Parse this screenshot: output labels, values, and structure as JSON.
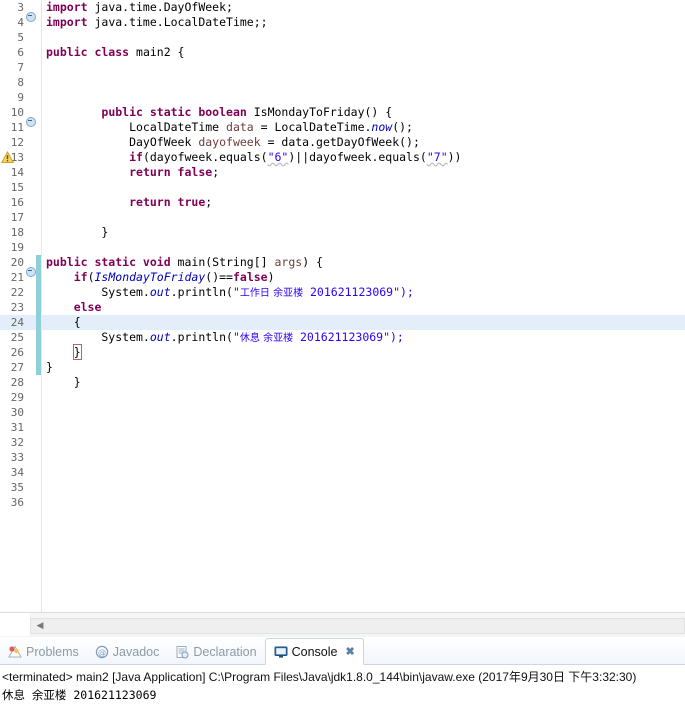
{
  "editor": {
    "first_line": 3,
    "current_line": 24,
    "warning_line": 13,
    "lines": [
      {
        "n": 3,
        "fold": true,
        "change": false,
        "warn": false,
        "tokens": [
          {
            "t": "import",
            "c": "kw"
          },
          {
            "t": " java.time.DayOfWeek;",
            "c": "pln"
          }
        ]
      },
      {
        "n": 4,
        "fold": false,
        "change": false,
        "warn": false,
        "tokens": [
          {
            "t": "import",
            "c": "kw"
          },
          {
            "t": " java.time.LocalDateTime;;",
            "c": "pln"
          }
        ]
      },
      {
        "n": 5,
        "fold": false,
        "change": false,
        "warn": false,
        "tokens": []
      },
      {
        "n": 6,
        "fold": false,
        "change": false,
        "warn": false,
        "tokens": [
          {
            "t": "public class",
            "c": "kw"
          },
          {
            "t": " main2 {",
            "c": "pln"
          }
        ]
      },
      {
        "n": 7,
        "fold": false,
        "change": false,
        "warn": false,
        "tokens": []
      },
      {
        "n": 8,
        "fold": false,
        "change": false,
        "warn": false,
        "tokens": []
      },
      {
        "n": 9,
        "fold": false,
        "change": false,
        "warn": false,
        "tokens": []
      },
      {
        "n": 10,
        "fold": true,
        "change": false,
        "warn": false,
        "tokens": [
          {
            "t": "        ",
            "c": "pln"
          },
          {
            "t": "public static boolean",
            "c": "kw"
          },
          {
            "t": " IsMondayToFriday() {",
            "c": "pln"
          }
        ]
      },
      {
        "n": 11,
        "fold": false,
        "change": false,
        "warn": false,
        "tokens": [
          {
            "t": "            LocalDateTime ",
            "c": "pln"
          },
          {
            "t": "data",
            "c": "param"
          },
          {
            "t": " = LocalDateTime.",
            "c": "pln"
          },
          {
            "t": "now",
            "c": "stat"
          },
          {
            "t": "();",
            "c": "pln"
          }
        ]
      },
      {
        "n": 12,
        "fold": false,
        "change": false,
        "warn": false,
        "tokens": [
          {
            "t": "            DayOfWeek ",
            "c": "pln"
          },
          {
            "t": "dayofweek",
            "c": "param"
          },
          {
            "t": " = data.getDayOfWeek();",
            "c": "pln"
          }
        ]
      },
      {
        "n": 13,
        "fold": false,
        "change": false,
        "warn": true,
        "tokens": [
          {
            "t": "            ",
            "c": "pln"
          },
          {
            "t": "if",
            "c": "kw"
          },
          {
            "t": "(dayofweek.equals(",
            "c": "pln"
          },
          {
            "t": "\"6\"",
            "c": "str sq"
          },
          {
            "t": ")||dayofweek.equals(",
            "c": "pln"
          },
          {
            "t": "\"7\"",
            "c": "str sq"
          },
          {
            "t": "))",
            "c": "pln"
          }
        ]
      },
      {
        "n": 14,
        "fold": false,
        "change": false,
        "warn": false,
        "tokens": [
          {
            "t": "            ",
            "c": "pln"
          },
          {
            "t": "return false",
            "c": "kw"
          },
          {
            "t": ";",
            "c": "pln"
          }
        ]
      },
      {
        "n": 15,
        "fold": false,
        "change": false,
        "warn": false,
        "tokens": []
      },
      {
        "n": 16,
        "fold": false,
        "change": false,
        "warn": false,
        "tokens": [
          {
            "t": "            ",
            "c": "pln"
          },
          {
            "t": "return true",
            "c": "kw"
          },
          {
            "t": ";",
            "c": "pln"
          }
        ]
      },
      {
        "n": 17,
        "fold": false,
        "change": false,
        "warn": false,
        "tokens": []
      },
      {
        "n": 18,
        "fold": false,
        "change": false,
        "warn": false,
        "tokens": [
          {
            "t": "        }",
            "c": "pln"
          }
        ]
      },
      {
        "n": 19,
        "fold": false,
        "change": false,
        "warn": false,
        "tokens": []
      },
      {
        "n": 20,
        "fold": true,
        "change": true,
        "warn": false,
        "tokens": [
          {
            "t": "public static void",
            "c": "kw"
          },
          {
            "t": " main(String[] ",
            "c": "pln"
          },
          {
            "t": "args",
            "c": "param"
          },
          {
            "t": ") {",
            "c": "pln"
          }
        ]
      },
      {
        "n": 21,
        "fold": false,
        "change": true,
        "warn": false,
        "tokens": [
          {
            "t": "    ",
            "c": "pln"
          },
          {
            "t": "if",
            "c": "kw"
          },
          {
            "t": "(",
            "c": "pln"
          },
          {
            "t": "IsMondayToFriday",
            "c": "stat"
          },
          {
            "t": "()==",
            "c": "pln"
          },
          {
            "t": "false",
            "c": "kw"
          },
          {
            "t": ")",
            "c": "pln"
          }
        ]
      },
      {
        "n": 22,
        "fold": false,
        "change": true,
        "warn": false,
        "tokens": [
          {
            "t": "        System.",
            "c": "pln"
          },
          {
            "t": "out",
            "c": "fld"
          },
          {
            "t": ".println(",
            "c": "pln"
          },
          {
            "t": "\"",
            "c": "str"
          },
          {
            "t": "工作日 余亚楼",
            "c": "str cjk"
          },
          {
            "t": " 201621123069\");",
            "c": "str"
          }
        ]
      },
      {
        "n": 23,
        "fold": false,
        "change": true,
        "warn": false,
        "tokens": [
          {
            "t": "    ",
            "c": "pln"
          },
          {
            "t": "else",
            "c": "kw"
          }
        ]
      },
      {
        "n": 24,
        "fold": false,
        "change": true,
        "warn": false,
        "tokens": [
          {
            "t": "    {",
            "c": "pln"
          }
        ]
      },
      {
        "n": 25,
        "fold": false,
        "change": true,
        "warn": false,
        "tokens": [
          {
            "t": "        System.",
            "c": "pln"
          },
          {
            "t": "out",
            "c": "fld"
          },
          {
            "t": ".println(",
            "c": "pln"
          },
          {
            "t": "\"",
            "c": "str"
          },
          {
            "t": "休息 余亚楼",
            "c": "str cjk"
          },
          {
            "t": " 201621123069\");",
            "c": "str"
          }
        ]
      },
      {
        "n": 26,
        "fold": false,
        "change": true,
        "warn": false,
        "tokens": [
          {
            "t": "    ",
            "c": "pln"
          },
          {
            "t": "}",
            "c": "pln bracketbox"
          }
        ]
      },
      {
        "n": 27,
        "fold": false,
        "change": true,
        "warn": false,
        "tokens": [
          {
            "t": "}",
            "c": "pln"
          }
        ]
      },
      {
        "n": 28,
        "fold": false,
        "change": false,
        "warn": false,
        "tokens": [
          {
            "t": "    }",
            "c": "pln"
          }
        ]
      },
      {
        "n": 29,
        "fold": false,
        "change": false,
        "warn": false,
        "tokens": []
      },
      {
        "n": 30,
        "fold": false,
        "change": false,
        "warn": false,
        "tokens": []
      },
      {
        "n": 31,
        "fold": false,
        "change": false,
        "warn": false,
        "tokens": []
      },
      {
        "n": 32,
        "fold": false,
        "change": false,
        "warn": false,
        "tokens": []
      },
      {
        "n": 33,
        "fold": false,
        "change": false,
        "warn": false,
        "tokens": []
      },
      {
        "n": 34,
        "fold": false,
        "change": false,
        "warn": false,
        "tokens": []
      },
      {
        "n": 35,
        "fold": false,
        "change": false,
        "warn": false,
        "tokens": []
      },
      {
        "n": 36,
        "fold": false,
        "change": false,
        "warn": false,
        "tokens": []
      }
    ]
  },
  "scrollbar": {
    "left_arrow": "◀"
  },
  "panel": {
    "tabs": [
      {
        "label": "Problems",
        "icon": "problems-icon",
        "active": false,
        "closable": false
      },
      {
        "label": "Javadoc",
        "icon": "javadoc-icon",
        "active": false,
        "closable": false
      },
      {
        "label": "Declaration",
        "icon": "declaration-icon",
        "active": false,
        "closable": false
      },
      {
        "label": "Console",
        "icon": "console-icon",
        "active": true,
        "closable": true
      }
    ],
    "close_glyph": "✖",
    "console": {
      "status": "<terminated> main2 [Java Application] C:\\Program Files\\Java\\jdk1.8.0_144\\bin\\javaw.exe (2017年9月30日 下午3:32:30)",
      "output_lines": [
        "休息 余亚楼 201621123069"
      ]
    }
  },
  "colors": {
    "keyword": "#7f0055",
    "string": "#2a00ff",
    "field": "#0000c0",
    "param": "#6a3e3e",
    "current_line_bg": "#e4eefb",
    "change_bar": "#8fd0d8",
    "gutter_text": "#666666",
    "tab_active_border": "#c8d6e5"
  }
}
